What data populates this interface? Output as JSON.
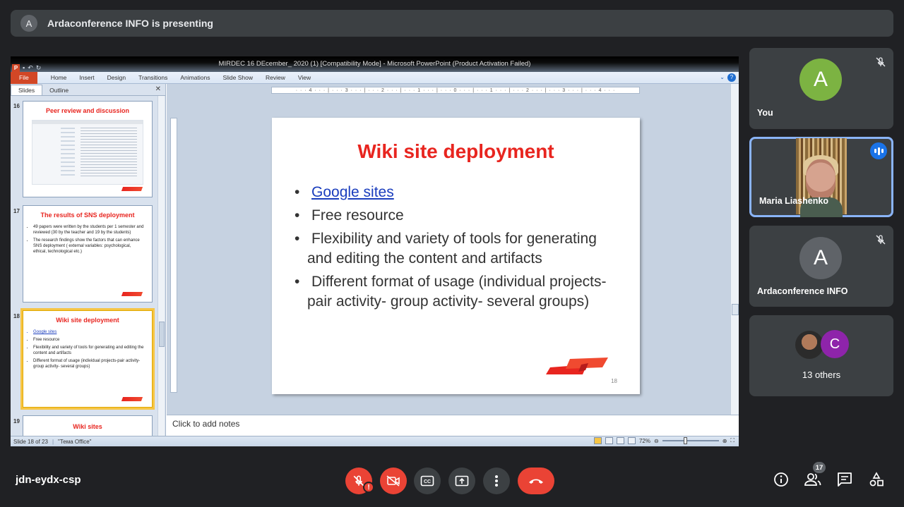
{
  "presenting": {
    "avatar_letter": "A",
    "text": "Ardaconference INFO is presenting"
  },
  "ppt": {
    "window_title": "MIRDEC 16 DEcember_ 2020 (1) [Compatibility Mode] - Microsoft PowerPoint (Product Activation Failed)",
    "app_icon": "P",
    "ribbon_tabs": [
      "File",
      "Home",
      "Insert",
      "Design",
      "Transitions",
      "Animations",
      "Slide Show",
      "Review",
      "View"
    ],
    "panel_tabs": [
      "Slides",
      "Outline"
    ],
    "ruler_text": "· · · 4 · · · | · · · 3 · · · | · · · 2 · · · | · · · 1 · · · | · · · 0 · · · | · · · 1 · · · | · · · 2 · · · | · · · 3 · · · | · · · 4 · · ·",
    "thumbnails": [
      {
        "num": "16",
        "title": "Peer review and discussion"
      },
      {
        "num": "17",
        "title": "The results of SNS deployment",
        "bullets": [
          "49 papers were written by the students per 1 semester and reviewed (30 by the teacher and 19 by the students)",
          "The research findings show the factors that can enhance SNS deployment ( external variables: psychological, ethical, technological etc.)"
        ]
      },
      {
        "num": "18",
        "title": "Wiki site deployment",
        "bullets": [
          "Google sites",
          "Free resource",
          "Flexibility and variety of tools for generating and editing the content and artifacts",
          "Different format of usage (individual projects-pair activity- group activity- several groups)"
        ]
      },
      {
        "num": "19",
        "title": "Wiki sites"
      }
    ],
    "slide": {
      "title": "Wiki site deployment",
      "bullets": [
        {
          "text": "Google sites",
          "link": true
        },
        {
          "text": "Free resource"
        },
        {
          "line1": "Flexibility and variety of tools for generating",
          "line2": "and editing the content and artifacts"
        },
        {
          "line1": "Different format of usage (individual projects-",
          "line2": "pair activity- group activity- several groups)"
        }
      ],
      "number": "18"
    },
    "notes_placeholder": "Click to add notes",
    "status": {
      "slide_of": "Slide 18 of 23",
      "theme": "\"Тема Office\"",
      "zoom": "72%"
    }
  },
  "participants": [
    {
      "name": "You",
      "avatar_letter": "A",
      "avatar_color": "#7cb342",
      "muted": true
    },
    {
      "name": "Maria Liashenko",
      "speaking": true,
      "video": true
    },
    {
      "name": "Ardaconference INFO",
      "avatar_letter": "A",
      "avatar_color": "#5f6368",
      "muted": true
    },
    {
      "name": "13 others",
      "avatar_letter": "C",
      "avatar_color": "#8e24aa"
    }
  ],
  "bottom": {
    "meeting_code": "jdn-eydx-csp",
    "warn_badge": "!",
    "participants_count": "17"
  },
  "colors": {
    "accent_red": "#ea4335",
    "active_blue": "#8ab4f8",
    "slide_title_red": "#e8251f"
  }
}
